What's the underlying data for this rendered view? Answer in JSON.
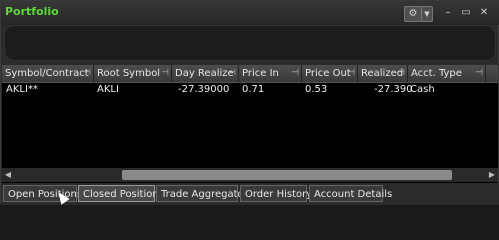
{
  "window": {
    "title": "Portfolio"
  },
  "titlebar": {
    "gear_icon": "gear-icon",
    "dropdown_icon": "chevron-down-icon",
    "minimize_glyph": "–",
    "restore_glyph": "▭",
    "close_glyph": "✕"
  },
  "grid": {
    "columns": [
      "Symbol/Contract",
      "Root Symbol",
      "Day Realize",
      "Price In",
      "Price Out",
      "Realized",
      "Acct. Type"
    ],
    "pin_glyph": "⊣",
    "rows": [
      [
        "AKLI**",
        "AKLI",
        "-27.39000",
        "0.71",
        "0.53",
        "-27.390",
        "Cash"
      ]
    ]
  },
  "tabs": [
    "Open Positions",
    "Closed Positions",
    "Trade Aggregator",
    "Order History",
    "Account Details"
  ],
  "active_tab": "Closed Positions",
  "colors": {
    "title": "#5fd73a",
    "background": "#000000"
  }
}
